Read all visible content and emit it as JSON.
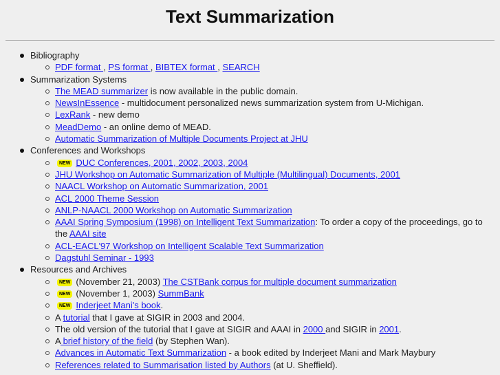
{
  "title": "Text Summarization",
  "new_badge": "NEW",
  "colors": {
    "link": "#1a1aee",
    "badge": "#f4f400"
  },
  "sections": [
    {
      "label": "Bibliography",
      "items": [
        [
          {
            "t": "PDF format ",
            "link": true
          },
          {
            "t": ", "
          },
          {
            "t": "PS format ",
            "link": true
          },
          {
            "t": ", "
          },
          {
            "t": "BIBTEX format ",
            "link": true
          },
          {
            "t": ", "
          },
          {
            "t": "SEARCH",
            "link": true
          }
        ]
      ]
    },
    {
      "label": "Summarization Systems",
      "items": [
        [
          {
            "t": "The MEAD summarizer",
            "link": true
          },
          {
            "t": " is now available in the public domain."
          }
        ],
        [
          {
            "t": "NewsInEssence",
            "link": true
          },
          {
            "t": " - multidocument personalized news summarization system from U-Michigan."
          }
        ],
        [
          {
            "t": "LexRank",
            "link": true
          },
          {
            "t": " - new demo"
          }
        ],
        [
          {
            "t": "MeadDemo",
            "link": true
          },
          {
            "t": " - an online demo of MEAD."
          }
        ],
        [
          {
            "t": "Automatic Summarization of Multiple Documents Project at JHU",
            "link": true
          }
        ]
      ]
    },
    {
      "label": "Conferences and Workshops",
      "items": [
        [
          {
            "badge": true
          },
          {
            "t": "DUC Conferences, 2001, 2002, 2003, 2004",
            "link": true
          }
        ],
        [
          {
            "t": "JHU Workshop on Automatic Summarization of Multiple (Multilingual) Documents, 2001",
            "link": true
          }
        ],
        [
          {
            "t": "NAACL Workshop on Automatic Summarization, 2001",
            "link": true
          }
        ],
        [
          {
            "t": "ACL 2000 Theme Session",
            "link": true
          }
        ],
        [
          {
            "t": "ANLP-NAACL 2000 Workshop on Automatic Summarization",
            "link": true
          }
        ],
        [
          {
            "t": "AAAI Spring Symposium (1998) on Intelligent Text Summarization",
            "link": true
          },
          {
            "t": ": To order a copy of the proceedings, go to the "
          },
          {
            "t": "AAAI site",
            "link": true
          }
        ],
        [
          {
            "t": "ACL-EACL'97 Workshop on Intelligent Scalable Text Summarization",
            "link": true
          }
        ],
        [
          {
            "t": "Dagstuhl Seminar - 1993",
            "link": true
          }
        ]
      ]
    },
    {
      "label": "Resources and Archives",
      "items": [
        [
          {
            "badge": true
          },
          {
            "t": "(November 21, 2003) "
          },
          {
            "t": "The CSTBank corpus for multiple document summarization",
            "link": true
          }
        ],
        [
          {
            "badge": true
          },
          {
            "t": "(November 1, 2003) "
          },
          {
            "t": "SummBank",
            "link": true
          }
        ],
        [
          {
            "badge": true
          },
          {
            "t": "Inderjeet Mani's book",
            "link": true
          },
          {
            "t": "."
          }
        ],
        [
          {
            "t": "A "
          },
          {
            "t": "tutorial",
            "link": true
          },
          {
            "t": " that I gave at SIGIR in 2003 and 2004."
          }
        ],
        [
          {
            "t": "The old version of the tutorial that I gave at SIGIR and AAAI in "
          },
          {
            "t": "2000 ",
            "link": true
          },
          {
            "t": "and SIGIR in "
          },
          {
            "t": "2001",
            "link": true
          },
          {
            "t": "."
          }
        ],
        [
          {
            "t": "A"
          },
          {
            "t": " brief history of the field",
            "link": true
          },
          {
            "t": " (by Stephen Wan)."
          }
        ],
        [
          {
            "t": "Advances in Automatic Text Summarization",
            "link": true
          },
          {
            "t": " - a book edited by Inderjeet Mani and Mark Maybury"
          }
        ],
        [
          {
            "t": "References related to Summarisation listed by Authors",
            "link": true
          },
          {
            "t": " (at U. Sheffield)."
          }
        ]
      ]
    }
  ]
}
